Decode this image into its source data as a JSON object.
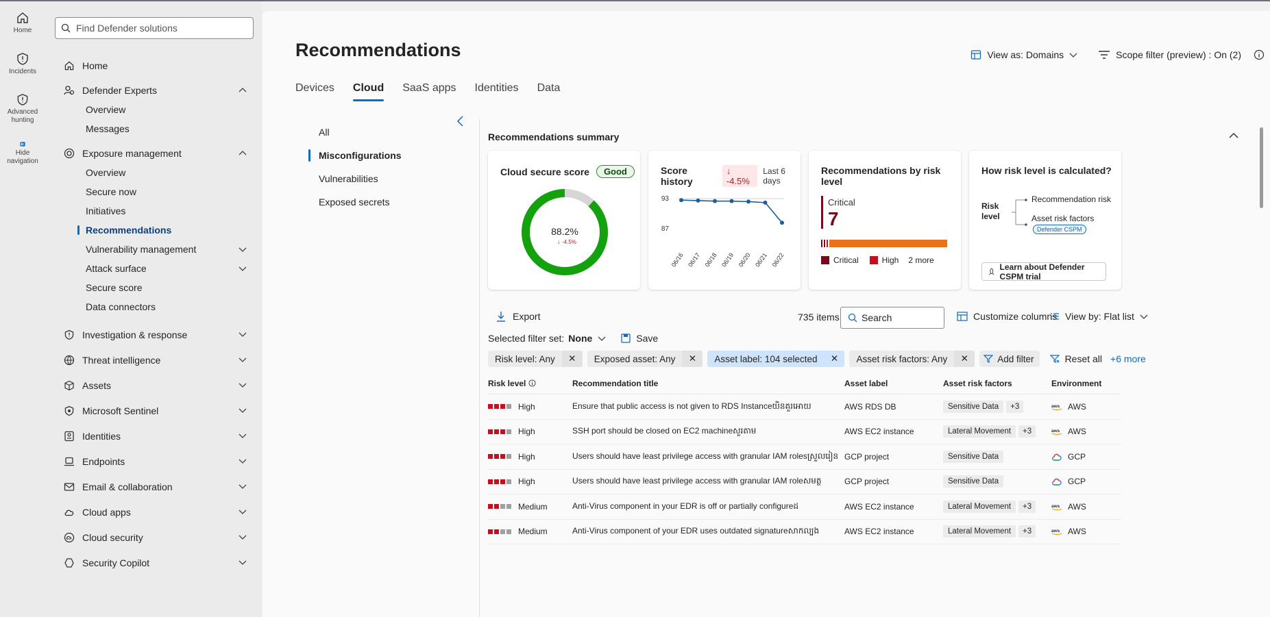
{
  "rail": [
    {
      "label": "Home",
      "icon": "home-icon"
    },
    {
      "label": "Incidents",
      "icon": "shield-icon"
    },
    {
      "label": "Advanced hunting",
      "icon": "shield-search-icon"
    },
    {
      "label": "Hide navigation",
      "icon": "hide-navigation-icon"
    }
  ],
  "search": {
    "placeholder": "Find Defender solutions"
  },
  "nav": {
    "home": "Home",
    "defender_experts": "Defender Experts",
    "de_overview": "Overview",
    "de_messages": "Messages",
    "exposure_management": "Exposure management",
    "em_overview": "Overview",
    "em_secure_now": "Secure now",
    "em_initiatives": "Initiatives",
    "em_recommendations": "Recommendations",
    "em_vuln": "Vulnerability management",
    "em_attack": "Attack surface",
    "em_secure_score": "Secure score",
    "em_data_connectors": "Data connectors",
    "investigation": "Investigation & response",
    "threat_intel": "Threat intelligence",
    "assets": "Assets",
    "sentinel": "Microsoft Sentinel",
    "identities": "Identities",
    "endpoints": "Endpoints",
    "email": "Email & collaboration",
    "cloud_apps": "Cloud apps",
    "cloud_security": "Cloud security",
    "security_copilot": "Security Copilot"
  },
  "page": {
    "title": "Recommendations",
    "view_as": "View as: Domains",
    "scope_filter": "Scope filter (preview) : On (2)"
  },
  "tabs": [
    "Devices",
    "Cloud",
    "SaaS apps",
    "Identities",
    "Data"
  ],
  "filters": [
    "All",
    "Misconfigurations",
    "Vulnerabilities",
    "Exposed secrets"
  ],
  "summary": {
    "heading": "Recommendations summary",
    "secure_score": {
      "title": "Cloud secure score",
      "badge": "Good",
      "value": "88.2%",
      "delta": "-4.5%",
      "fraction": 0.882
    },
    "history": {
      "title": "Score history",
      "delta": "-4.5%",
      "note": "Last 6 days",
      "y_top": "93",
      "y_bottom": "87"
    },
    "risk": {
      "title": "Recommendations by risk level",
      "label": "Critical",
      "count": "7",
      "legend_critical": "Critical",
      "legend_high": "High",
      "legend_more": "2 more"
    },
    "how": {
      "title": "How risk level is calculated?",
      "risk_level": "Risk level",
      "rec_risk": "Recommendation risk",
      "asset_risk": "Asset risk factors",
      "badge": "Defender CSPM",
      "learn": "Learn about Defender CSPM trial"
    }
  },
  "chart_data": {
    "type": "line",
    "title": "Score history",
    "x": [
      "06/16",
      "06/17",
      "06/18",
      "06/19",
      "06/20",
      "06/21",
      "06/22"
    ],
    "series": [
      {
        "values": [
          92.7,
          92.6,
          92.5,
          92.5,
          92.4,
          92.2,
          88.2
        ]
      }
    ],
    "ylim": [
      87,
      93
    ],
    "grid": false
  },
  "toolbar": {
    "export": "Export",
    "items": "735 items",
    "search_placeholder": "Search",
    "customize": "Customize columns",
    "view_by": "View by: Flat list",
    "filter_set_label": "Selected filter set:",
    "filter_set_value": "None",
    "save": "Save"
  },
  "chips": [
    {
      "label": "Risk level: Any"
    },
    {
      "label": "Exposed asset: Any"
    },
    {
      "label": "Asset label: 104 selected"
    },
    {
      "label": "Asset risk factors: Any"
    }
  ],
  "chip_actions": {
    "add_filter": "Add filter",
    "reset_all": "Reset all",
    "more": "+6 more"
  },
  "table": {
    "headers": [
      "Risk level",
      "Recommendation title",
      "Asset label",
      "Asset risk factors",
      "Environment"
    ],
    "rows": [
      {
        "risk": "High",
        "title": "Ensure that public access is not given to RDS Instanceយិនគួរអោយ",
        "asset": "AWS RDS DB",
        "factor": "Sensitive Data",
        "plus": "+3",
        "env": "AWS"
      },
      {
        "risk": "High",
        "title": "SSH port should be closed on EC2 machineសួរតាម",
        "asset": "AWS EC2 instance",
        "factor": "Lateral Movement",
        "plus": "+3",
        "env": "AWS"
      },
      {
        "risk": "High",
        "title": "Users should have least privilege access with granular IAM rolesស្រួលរៀន",
        "asset": "GCP project",
        "factor": "Sensitive Data",
        "plus": "",
        "env": "GCP"
      },
      {
        "risk": "High",
        "title": "Users should have least privilege access with granular IAM roleសមត្ថ",
        "asset": "GCP project",
        "factor": "Sensitive Data",
        "plus": "",
        "env": "GCP"
      },
      {
        "risk": "Medium",
        "title": "Anti-Virus component in your EDR is off or partially configureដ",
        "asset": "AWS EC2 instance",
        "factor": "Lateral Movement",
        "plus": "+3",
        "env": "AWS"
      },
      {
        "risk": "Medium",
        "title": "Anti-Virus component of your EDR uses outdated signatureសាកល្បង",
        "asset": "AWS EC2 instance",
        "factor": "Lateral Movement",
        "plus": "+3",
        "env": "AWS"
      }
    ]
  },
  "colors": {
    "accent": "#0f6cbd",
    "critical": "#750b1c",
    "high": "#c50f1f",
    "orange": "#e8711a",
    "good": "#13a10e"
  }
}
